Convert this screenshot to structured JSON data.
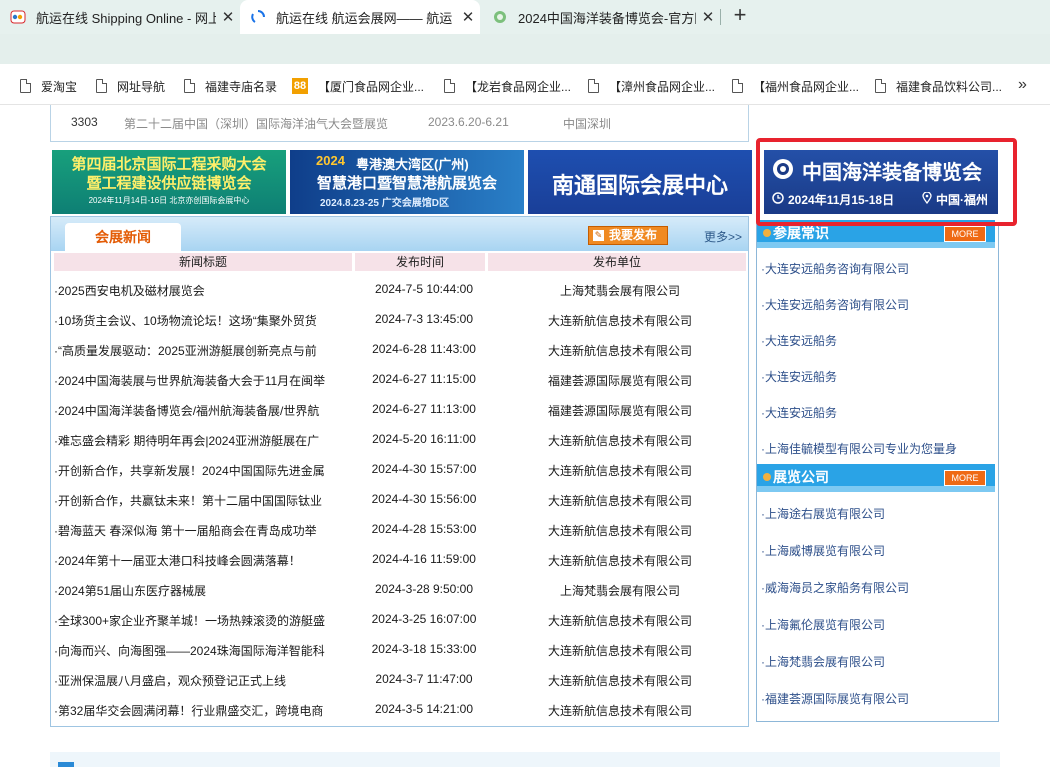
{
  "browser": {
    "tabs": [
      {
        "title": "航运在线 Shipping Online - 网上"
      },
      {
        "title": "航运在线 航运会展网—— 航运"
      },
      {
        "title": "2024中国海洋装备博览会-官方网"
      }
    ],
    "bookmarks": [
      {
        "label": "爱淘宝"
      },
      {
        "label": "网址导航"
      },
      {
        "label": "福建寺庙名录"
      },
      {
        "label": "【厦门食品网企业..."
      },
      {
        "label": "【龙岩食品网企业..."
      },
      {
        "label": "【漳州食品网企业..."
      },
      {
        "label": "【福州食品网企业..."
      },
      {
        "label": "福建食品饮料公司..."
      }
    ],
    "badge_88": "88"
  },
  "prev_row": {
    "id": "3303",
    "name": "第二十二届中国（深圳）国际海洋油气大会暨展览",
    "date": "2023.6.20-6.21",
    "place": "中国深圳"
  },
  "banners": [
    {
      "line1": "第四届北京国际工程采购大会",
      "line2": "暨工程建设供应链博览会",
      "line3": "2024年11月14日-16日    北京亦创国际会展中心"
    },
    {
      "line1": "粤港澳大湾区(广州)",
      "line2": "智慧港口暨智慧港航展览会",
      "line3": "2024.8.23-25  广交会展馆D区",
      "logo": "2024"
    },
    {
      "line1": "南通国际会展中心"
    },
    {
      "line1": "中国海洋装备博览会",
      "date": "2024年11月15-18日",
      "place": "中国·福州"
    }
  ],
  "news": {
    "tab_label": "会展新闻",
    "publish_label": "我要发布",
    "more_label": "更多>>",
    "columns": [
      "新闻标题",
      "发布时间",
      "发布单位"
    ],
    "rows": [
      {
        "title": "·2025西安电机及磁材展览会",
        "time": "2024-7-5 10:44:00",
        "org": "上海梵翡会展有限公司"
      },
      {
        "title": "·10场货主会议、10场物流论坛！这场“集聚外贸货",
        "time": "2024-7-3 13:45:00",
        "org": "大连新航信息技术有限公司"
      },
      {
        "title": "·“高质量发展驱动：2025亚洲游艇展创新亮点与前",
        "time": "2024-6-28 11:43:00",
        "org": "大连新航信息技术有限公司"
      },
      {
        "title": "·2024中国海装展与世界航海装备大会于11月在闽举",
        "time": "2024-6-27 11:15:00",
        "org": "福建荟源国际展览有限公司"
      },
      {
        "title": "·2024中国海洋装备博览会/福州航海装备展/世界航",
        "time": "2024-6-27 11:13:00",
        "org": "福建荟源国际展览有限公司"
      },
      {
        "title": "·难忘盛会精彩 期待明年再会|2024亚洲游艇展在广",
        "time": "2024-5-20 16:11:00",
        "org": "大连新航信息技术有限公司"
      },
      {
        "title": "·开创新合作，共享新发展！2024中国国际先进金属",
        "time": "2024-4-30 15:57:00",
        "org": "大连新航信息技术有限公司"
      },
      {
        "title": "·开创新合作，共赢钛未来！第十二届中国国际钛业",
        "time": "2024-4-30 15:56:00",
        "org": "大连新航信息技术有限公司"
      },
      {
        "title": "·碧海蓝天 春深似海 第十一届船商会在青岛成功举",
        "time": "2024-4-28 15:53:00",
        "org": "大连新航信息技术有限公司"
      },
      {
        "title": "·2024年第十一届亚太港口科技峰会圆满落幕！",
        "time": "2024-4-16 11:59:00",
        "org": "大连新航信息技术有限公司"
      },
      {
        "title": "·2024第51届山东医疗器械展",
        "time": "2024-3-28 9:50:00",
        "org": "上海梵翡会展有限公司"
      },
      {
        "title": "·全球300+家企业齐聚羊城！一场热辣滚烫的游艇盛",
        "time": "2024-3-25 16:07:00",
        "org": "大连新航信息技术有限公司"
      },
      {
        "title": "·向海而兴、向海图强——2024珠海国际海洋智能科",
        "time": "2024-3-18 15:33:00",
        "org": "大连新航信息技术有限公司"
      },
      {
        "title": "·亚洲保温展八月盛启，观众预登记正式上线",
        "time": "2024-3-7 11:47:00",
        "org": "大连新航信息技术有限公司"
      },
      {
        "title": "·第32届华交会圆满闭幕！行业鼎盛交汇，跨境电商",
        "time": "2024-3-5 14:21:00",
        "org": "大连新航信息技术有限公司"
      }
    ]
  },
  "sidebar": {
    "knowledge_title": "参展常识",
    "knowledge_more": "MORE",
    "knowledge_items": [
      "·大连安远船务咨询有限公司",
      "·大连安远船务咨询有限公司",
      "·大连安远船务",
      "·大连安远船务",
      "·大连安远船务",
      "·上海佳毓模型有限公司专业为您量身"
    ],
    "companies_title": "展览公司",
    "companies_more": "MORE",
    "companies_items": [
      "·上海途右展览有限公司",
      "·上海威博展览有限公司",
      "·威海海员之家船务有限公司",
      "·上海氟伦展览有限公司",
      "·上海梵翡会展有限公司",
      "·福建荟源国际展览有限公司"
    ]
  },
  "colors": {
    "highlight": "#e8232e",
    "header_blue": "#2aa3e6",
    "accent_orange": "#ef6a14",
    "link_blue": "#2d4f8a"
  }
}
